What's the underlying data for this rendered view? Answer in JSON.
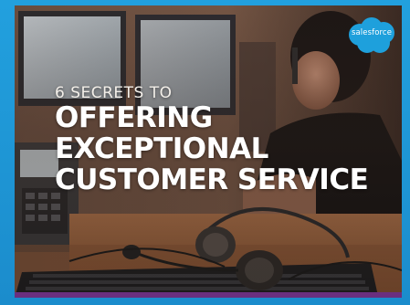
{
  "cover": {
    "subtitle": "6 SECRETS TO",
    "title_lines": [
      "OFFERING",
      "EXCEPTIONAL",
      "CUSTOMER SERVICE"
    ],
    "brand": "salesforce"
  },
  "colors": {
    "frame": "#1c93d1",
    "brand_cloud": "#1ea0dc",
    "accent_bar": "#6a2f7f",
    "title_text": "#ffffff"
  },
  "icons": [
    "salesforce-cloud-logo",
    "headset-icon",
    "keyboard-icon",
    "monitor-icon",
    "desk-phone-icon"
  ]
}
